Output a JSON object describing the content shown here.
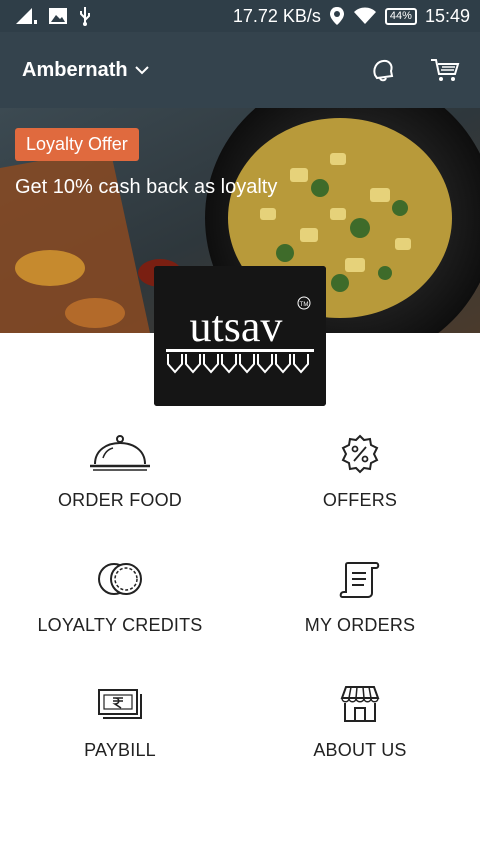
{
  "status_bar": {
    "network_speed": "17.72 KB/s",
    "battery": "44%",
    "time": "15:49",
    "icons": [
      "signal-icon",
      "gallery-icon",
      "usb-icon",
      "location-icon",
      "wifi-icon",
      "battery-icon"
    ]
  },
  "app_bar": {
    "location": "Ambernath",
    "icons": [
      "chevron-down-icon",
      "notification-icon",
      "cart-icon"
    ]
  },
  "banner": {
    "badge": "Loyalty Offer",
    "text": "Get 10% cash back as loyalty"
  },
  "logo": {
    "text": "utsav",
    "mark": "TM"
  },
  "menu": [
    {
      "label": "ORDER FOOD",
      "icon": "cloche-icon"
    },
    {
      "label": "OFFERS",
      "icon": "percent-badge-icon"
    },
    {
      "label": "LOYALTY CREDITS",
      "icon": "coins-icon"
    },
    {
      "label": "MY ORDERS",
      "icon": "receipt-icon"
    },
    {
      "label": "PAYBILL",
      "icon": "rupee-note-icon"
    },
    {
      "label": "ABOUT US",
      "icon": "storefront-icon"
    }
  ],
  "colors": {
    "status_bar": "#2f3e48",
    "app_bar": "#34434d",
    "badge": "#e06a3e"
  }
}
